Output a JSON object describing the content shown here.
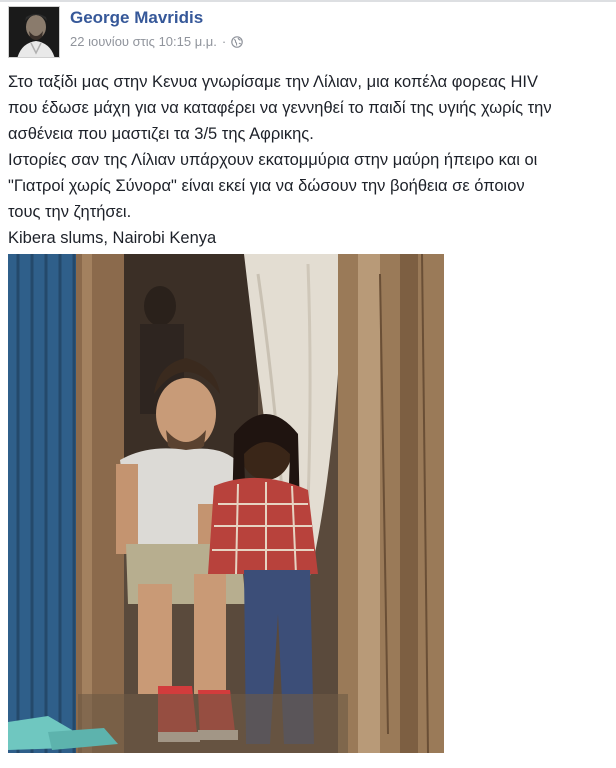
{
  "post": {
    "author": "George Mavridis",
    "timestamp": "22 ιουνίου στις 10:15 μ.μ.",
    "separator": "·",
    "privacy_icon": "globe-icon",
    "text_lines": [
      "Στο ταξίδι μας στην Κενυα γνωρίσαμε την Λίλιαν, μια κοπέλα φορεας HIV",
      "που έδωσε μάχη για να καταφέρει να γεννηθεί το παιδί της υγιής χωρίς την",
      "ασθένεια που μαστιζει τα 3/5 της Αφρικης.",
      "Ιστορίες σαν της Λίλιαν υπάρχουν εκατομμύρια στην μαύρη ήπειρο και οι",
      "\"Γιατροί χωρίς Σύνορα\" είναι εκεί για να δώσουν την βοήθεια σε όποιον",
      "τους την ζητήσει.",
      "Kibera slums, Nairobi Kenya"
    ]
  },
  "colors": {
    "author_link": "#365899",
    "meta_text": "#90949c",
    "body_text": "#1d2129"
  }
}
